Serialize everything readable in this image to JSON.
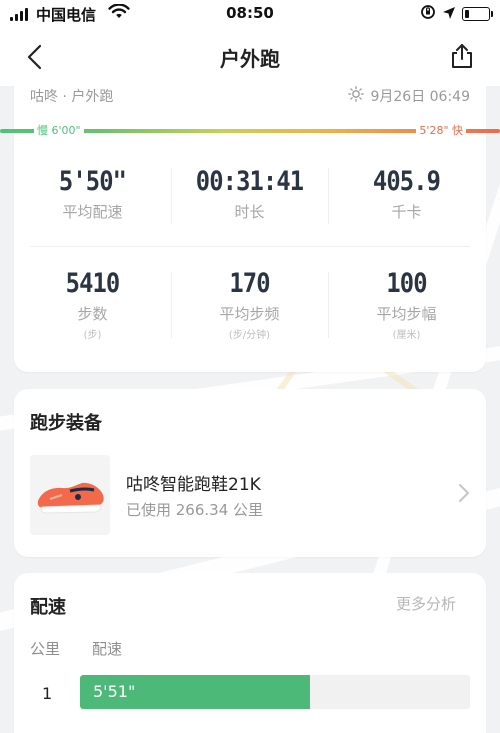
{
  "status_bar": {
    "carrier": "中国电信",
    "time": "08:50"
  },
  "nav": {
    "title": "户外跑"
  },
  "summary": {
    "source": "咕咚 · 户外跑",
    "datetime": "9月26日 06:49",
    "pace_slow": "慢 6'00\"",
    "pace_fast": "5'28\" 快",
    "stats_row1": [
      {
        "value": "5'50\"",
        "label": "平均配速"
      },
      {
        "value": "00:31:41",
        "label": "时长"
      },
      {
        "value": "405.9",
        "label": "千卡"
      }
    ],
    "stats_row2": [
      {
        "value": "5410",
        "label": "步数",
        "unit": "(步)"
      },
      {
        "value": "170",
        "label": "平均步频",
        "unit": "(步/分钟)"
      },
      {
        "value": "100",
        "label": "平均步幅",
        "unit": "(厘米)"
      }
    ]
  },
  "gear": {
    "title": "跑步装备",
    "shoe_name": "咕咚智能跑鞋21K",
    "usage": "已使用 266.34 公里"
  },
  "pace": {
    "title": "配速",
    "more": "更多分析",
    "col_km": "公里",
    "col_pace": "配速",
    "rows": [
      {
        "km": "1",
        "pace": "5'51\"",
        "fill_fraction": 0.59
      }
    ]
  },
  "colors": {
    "accent_green": "#4cb978",
    "fast_orange": "#ed6a4b"
  }
}
